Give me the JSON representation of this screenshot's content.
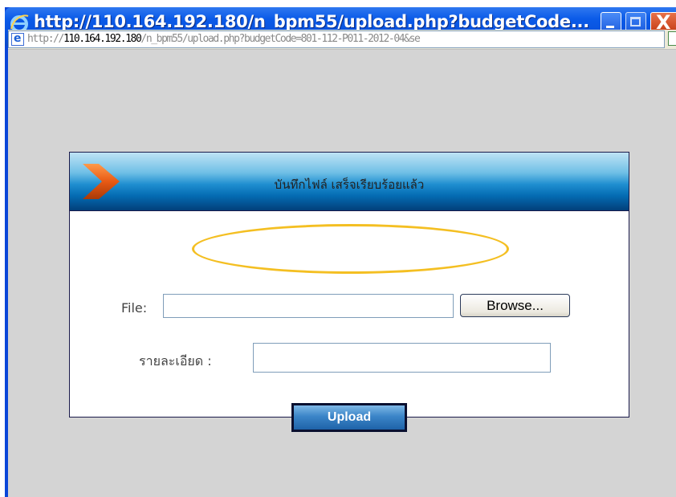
{
  "window": {
    "title": "http://110.164.192.180/n_bpm55/upload.php?budgetCode...",
    "minimize_icon": "minimize-icon",
    "maximize_icon": "maximize-icon",
    "close_icon": "close-icon",
    "close_glyph": "X"
  },
  "address_bar": {
    "url_prefix": "http://",
    "url_host": "110.164.192.180",
    "url_path": "/n_bpm55/upload.php?budgetCode=801-112-P011-2012-04&se"
  },
  "dialog": {
    "success_message": "บันทึกไฟล์ เสร็จเรียบร้อยแล้ว",
    "file_label": "File:",
    "file_value": "",
    "browse_label": "Browse...",
    "detail_label": "รายละเอียด :",
    "detail_value": "",
    "upload_label": "Upload"
  },
  "colors": {
    "title_bar": "#0a5ae6",
    "header_blue": "#046bb2",
    "highlight_oval": "#f4bf22",
    "arrow_orange": "#e85a14"
  }
}
